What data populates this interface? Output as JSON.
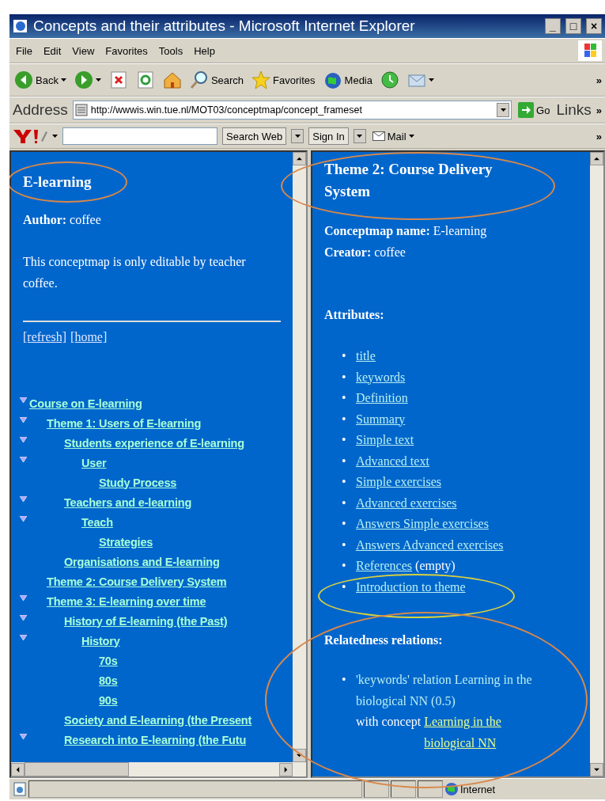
{
  "window": {
    "title": "Concepts and their attributes - Microsoft Internet Explorer",
    "controls": [
      "_",
      "□",
      "×"
    ]
  },
  "menu": [
    "File",
    "Edit",
    "View",
    "Favorites",
    "Tools",
    "Help"
  ],
  "toolbar": {
    "items": [
      {
        "kind": "back",
        "label": "Back",
        "dropdown": true
      },
      {
        "kind": "forward",
        "dropdown": true
      },
      {
        "kind": "stop",
        "dropdown": false
      },
      {
        "kind": "refresh",
        "dropdown": false
      },
      {
        "kind": "home",
        "dropdown": false
      },
      {
        "kind": "search",
        "label": "Search",
        "dropdown": false
      },
      {
        "kind": "favorites",
        "label": "Favorites",
        "dropdown": false
      },
      {
        "kind": "media",
        "label": "Media",
        "dropdown": false
      },
      {
        "kind": "history",
        "dropdown": false
      },
      {
        "kind": "mail",
        "dropdown": true
      }
    ],
    "more": "»"
  },
  "address": {
    "label": "Address",
    "value": "http://wwwis.win.tue.nl/MOT03/conceptmap/concept_frameset",
    "go": "Go",
    "links": "Links",
    "more": "»"
  },
  "yahoo_bar": {
    "search_button": "Search Web",
    "sign_in": "Sign In",
    "mail": "Mail",
    "more": "»"
  },
  "left_frame": {
    "title": "E-learning",
    "title_circled": true,
    "author_label": "Author:",
    "author": "coffee",
    "note": "This conceptmap is only editable by teacher coffee.",
    "links": [
      "[refresh]",
      "[home]"
    ],
    "tree": [
      {
        "label": "Course on E-learning",
        "expanded": true,
        "children": [
          {
            "label": "Theme 1: Users of E-learning",
            "expanded": true,
            "children": [
              {
                "label": "Students experience of E-learning",
                "expanded": true,
                "children": [
                  {
                    "label": "User",
                    "expanded": true,
                    "children": [
                      {
                        "label": "Study Process",
                        "expanded": false
                      }
                    ]
                  }
                ]
              },
              {
                "label": "Teachers and e-learning",
                "expanded": true,
                "children": [
                  {
                    "label": "Teach",
                    "expanded": true,
                    "children": [
                      {
                        "label": "Strategies",
                        "expanded": false
                      }
                    ]
                  }
                ]
              },
              {
                "label": "Organisations and E-learning",
                "expanded": false
              }
            ]
          },
          {
            "label": "Theme 2: Course Delivery System",
            "expanded": false
          },
          {
            "label": "Theme 3: E-learning over time",
            "expanded": true,
            "children": [
              {
                "label": "History of E-learning (the Past)",
                "expanded": true,
                "children": [
                  {
                    "label": "History",
                    "expanded": true,
                    "children": [
                      {
                        "label": "70s",
                        "expanded": false
                      },
                      {
                        "label": "80s",
                        "expanded": false
                      },
                      {
                        "label": "90s",
                        "expanded": false
                      }
                    ]
                  }
                ]
              },
              {
                "label": "Society and E-learning (the Present",
                "expanded": false
              },
              {
                "label": "Research into E-learning (the Futu",
                "expanded": true
              }
            ]
          }
        ]
      }
    ]
  },
  "right_frame": {
    "title": "Theme 2: Course Delivery System",
    "title_circled": true,
    "conceptmap_label": "Conceptmap name:",
    "conceptmap": "E-learning",
    "creator_label": "Creator:",
    "creator": "coffee",
    "attributes_heading": "Attributes:",
    "attributes": [
      {
        "bullet": "•",
        "label": "title",
        "circled": false
      },
      {
        "bullet": "•",
        "label": "keywords",
        "circled": false
      },
      {
        "bullet": "•",
        "label": "Definition",
        "circled": false
      },
      {
        "bullet": "•",
        "label": "Summary",
        "circled": false
      },
      {
        "bullet": "•",
        "label": "Simple text",
        "circled": false
      },
      {
        "bullet": "•",
        "label": "Advanced text",
        "circled": false
      },
      {
        "bullet": "•",
        "label": "Simple exercises",
        "circled": false
      },
      {
        "bullet": "•",
        "label": "Advanced exercises",
        "circled": false
      },
      {
        "bullet": "•",
        "label": "Answers Simple exercises",
        "circled": false
      },
      {
        "bullet": "•",
        "label": "Answers Advanced exercises",
        "circled": false
      },
      {
        "bullet": "•",
        "label": "References",
        "note": "(empty)",
        "circled": false
      },
      {
        "bullet": "•",
        "label": "Introduction to theme",
        "circled": true
      }
    ],
    "relations_heading": "Relatedness relations:",
    "relations_circled": true,
    "relations": [
      {
        "bullet": "•",
        "text": "'keywords' relation Learning in the biological NN (0.5)",
        "prefix": "with concept",
        "link": "Learning in the biological NN"
      }
    ]
  },
  "status_bar": {
    "zone": "Internet"
  }
}
